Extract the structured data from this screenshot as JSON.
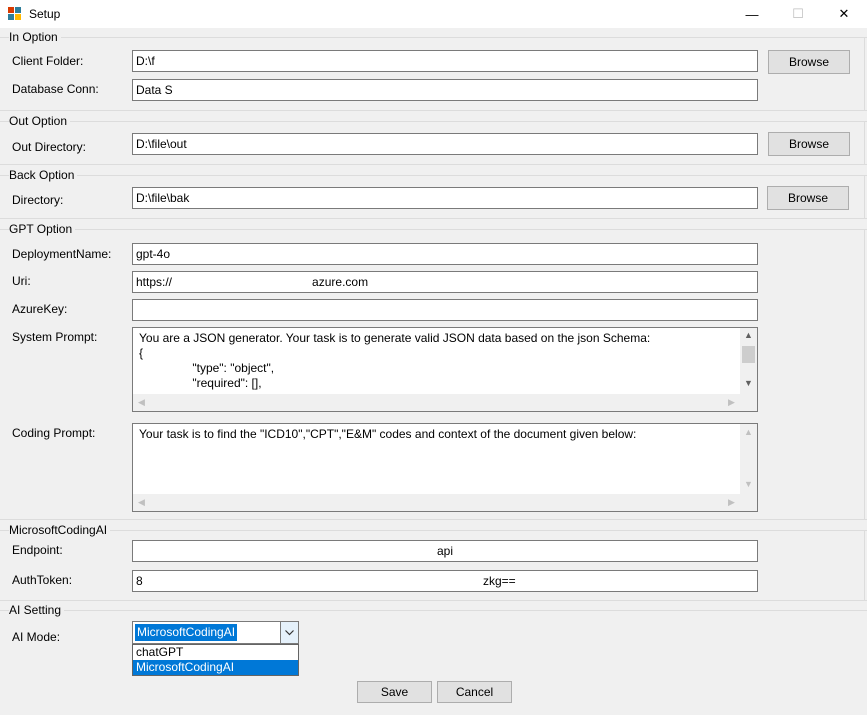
{
  "window": {
    "title": "Setup"
  },
  "in_option": {
    "title": "In Option",
    "client_folder_label": "Client Folder:",
    "client_folder_value": "D:\\f",
    "database_conn_label": "Database Conn:",
    "database_conn_value": "Data S",
    "browse_label": "Browse"
  },
  "out_option": {
    "title": "Out Option",
    "out_directory_label": "Out Directory:",
    "out_directory_value": "D:\\file\\out",
    "browse_label": "Browse"
  },
  "back_option": {
    "title": "Back Option",
    "directory_label": "Directory:",
    "directory_value": "D:\\file\\bak",
    "browse_label": "Browse"
  },
  "gpt_option": {
    "title": "GPT Option",
    "deployment_name_label": "DeploymentName:",
    "deployment_name_value": "gpt-4o",
    "uri_label": "Uri:",
    "uri_value": "https://                                          azure.com",
    "azure_key_label": "AzureKey:",
    "azure_key_value": "",
    "system_prompt_label": "System Prompt:",
    "system_prompt_value": "You are a JSON generator. Your task is to generate valid JSON data based on the json Schema:\n{\n                \"type\": \"object\",\n                \"required\": [],",
    "coding_prompt_label": "Coding Prompt:",
    "coding_prompt_value": "Your task is to find the \"ICD10\",\"CPT\",\"E&M\" codes and context of the document given below:"
  },
  "microsoft_coding_ai": {
    "title": "MicrosoftCodingAI",
    "endpoint_label": "Endpoint:",
    "endpoint_value": "api",
    "auth_token_label": "AuthToken:",
    "auth_token_prefix": "8",
    "auth_token_value": "zkg=="
  },
  "ai_setting": {
    "title": "AI Setting",
    "ai_mode_label": "AI Mode:",
    "ai_mode_selected": "MicrosoftCodingAI",
    "options": [
      "chatGPT",
      "MicrosoftCodingAI"
    ]
  },
  "footer": {
    "save_label": "Save",
    "cancel_label": "Cancel"
  },
  "colors": {
    "selection": "#0078d7",
    "button_face": "#e1e1e1",
    "form_bg": "#f0f0f0"
  },
  "icons": {
    "app": "app-icon",
    "minimize": "minimize-icon",
    "maximize": "maximize-icon",
    "close": "close-icon"
  }
}
